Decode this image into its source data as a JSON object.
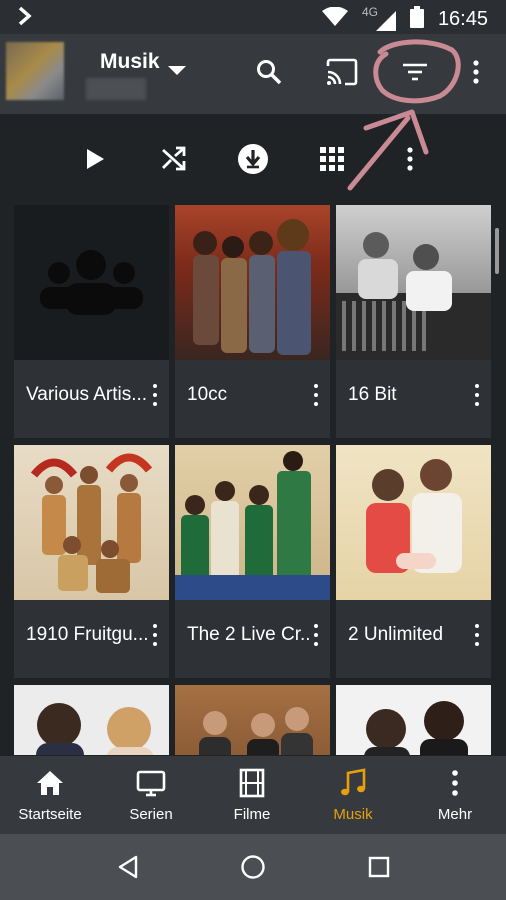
{
  "status_bar": {
    "network": "4G",
    "time": "16:45"
  },
  "toolbar": {
    "library_title": "Musik"
  },
  "tiles": [
    {
      "name": "Various Artis..."
    },
    {
      "name": "10cc"
    },
    {
      "name": "16 Bit"
    },
    {
      "name": "1910 Fruitgu..."
    },
    {
      "name": "The 2 Live Cr..."
    },
    {
      "name": "2 Unlimited"
    },
    {
      "name": ""
    },
    {
      "name": ""
    },
    {
      "name": ""
    }
  ],
  "bottom_nav": {
    "items": [
      {
        "label": "Startseite"
      },
      {
        "label": "Serien"
      },
      {
        "label": "Filme"
      },
      {
        "label": "Musik"
      },
      {
        "label": "Mehr"
      }
    ]
  },
  "colors": {
    "accent": "#e5a00d",
    "toolbar": "#363a3e",
    "background": "#1f2326",
    "annotation": "#c98a94"
  }
}
